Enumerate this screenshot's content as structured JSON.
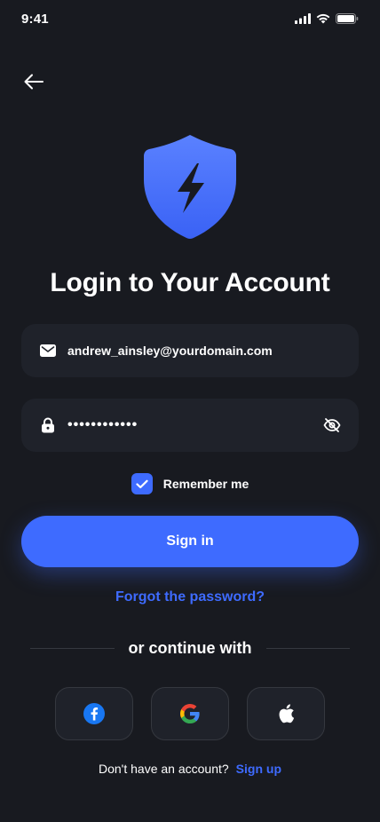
{
  "status_bar": {
    "time": "9:41"
  },
  "title": "Login to Your Account",
  "email_field": {
    "value": "andrew_ainsley@yourdomain.com"
  },
  "password_field": {
    "value": "••••••••••••"
  },
  "remember": {
    "label": "Remember me",
    "checked": true
  },
  "sign_in_label": "Sign in",
  "forgot_label": "Forgot the password?",
  "divider_label": "or continue with",
  "signup": {
    "question": "Don't have an account?",
    "link": "Sign up"
  },
  "colors": {
    "accent": "#3E6BFF",
    "background": "#181A20",
    "field_bg": "#1F222A"
  }
}
